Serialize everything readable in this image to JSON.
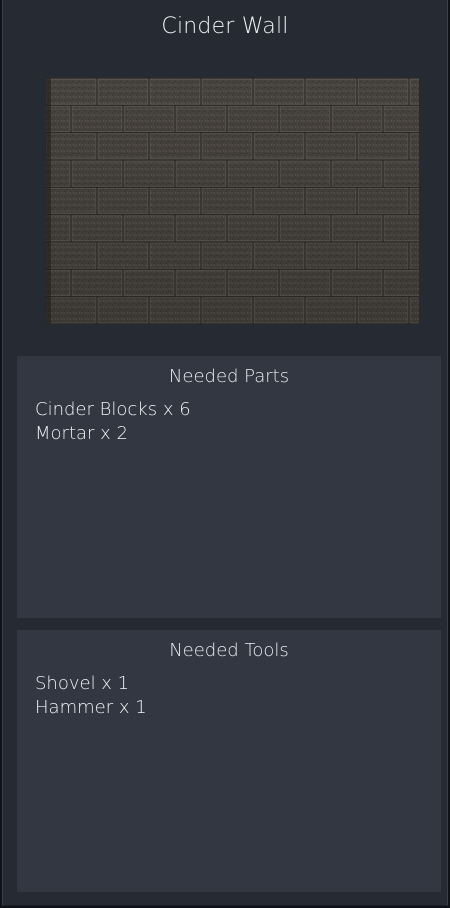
{
  "item": {
    "title": "Cinder Wall",
    "preview_icon": "cinder-wall-texture"
  },
  "parts": {
    "heading": "Needed Parts",
    "items": [
      "Cinder Blocks x 6",
      "Mortar x 2"
    ]
  },
  "tools": {
    "heading": "Needed Tools",
    "items": [
      "Shovel x 1",
      "Hammer x 1"
    ]
  },
  "colors": {
    "panel": "#252a33",
    "box": "#323742",
    "text": "#f1f2f4",
    "brick": "#4d4944",
    "mortar": "#7a7670"
  }
}
